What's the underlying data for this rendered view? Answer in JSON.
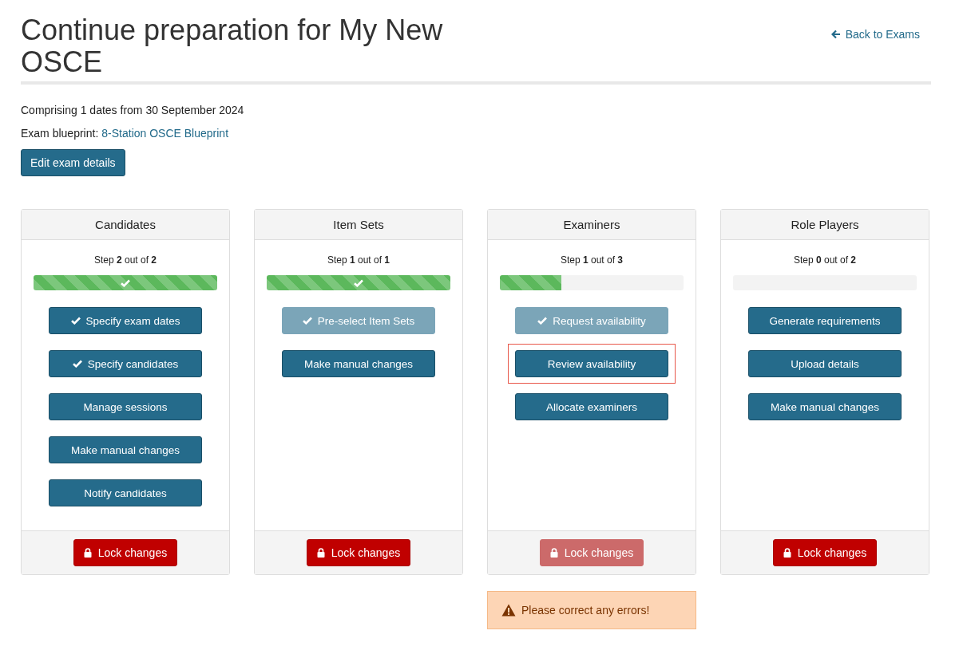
{
  "title": "Continue preparation for My New OSCE",
  "back_link": "Back to Exams",
  "summary": "Comprising 1 dates from 30 September 2024",
  "blueprint": {
    "label": "Exam blueprint:",
    "link": "8-Station OSCE Blueprint"
  },
  "edit_button": "Edit exam details",
  "cards": [
    {
      "title": "Candidates",
      "step": "Step **2** out of **2**",
      "level": 1,
      "actions": [
        {
          "label": "Specify exam dates",
          "done": true,
          "disabled": false,
          "highlighted": false
        },
        {
          "label": "Specify candidates",
          "done": true,
          "disabled": false,
          "highlighted": false
        },
        {
          "label": "Manage sessions",
          "done": false,
          "disabled": false,
          "highlighted": false
        },
        {
          "label": "Make manual changes",
          "done": false,
          "disabled": false,
          "highlighted": false
        },
        {
          "label": "Notify candidates",
          "done": false,
          "disabled": false,
          "highlighted": false
        }
      ],
      "lock": {
        "label": "Lock changes",
        "disabled": false
      }
    },
    {
      "title": "Item Sets",
      "step": "Step **1** out of **1**",
      "level": 1,
      "actions": [
        {
          "label": "Pre-select Item Sets",
          "done": true,
          "disabled": true,
          "highlighted": false
        },
        {
          "label": "Make manual changes",
          "done": false,
          "disabled": false,
          "highlighted": false
        }
      ],
      "lock": {
        "label": "Lock changes",
        "disabled": false
      }
    },
    {
      "title": "Examiners",
      "step": "Step **1** out of **3**",
      "level": 0.333,
      "actions": [
        {
          "label": "Request availability",
          "done": true,
          "disabled": true,
          "highlighted": false
        },
        {
          "label": "Review availability",
          "done": false,
          "disabled": false,
          "highlighted": true
        },
        {
          "label": "Allocate examiners",
          "done": false,
          "disabled": false,
          "highlighted": false
        }
      ],
      "lock": {
        "label": "Lock changes",
        "disabled": true
      },
      "alert": "Please correct any errors!"
    },
    {
      "title": "Role Players",
      "step": "Step **0** out of **2**",
      "level": 0,
      "actions": [
        {
          "label": "Generate requirements",
          "done": false,
          "disabled": false,
          "highlighted": false
        },
        {
          "label": "Upload details",
          "done": false,
          "disabled": false,
          "highlighted": false
        },
        {
          "label": "Make manual changes",
          "done": false,
          "disabled": false,
          "highlighted": false
        }
      ],
      "lock": {
        "label": "Lock changes",
        "disabled": false
      }
    }
  ]
}
